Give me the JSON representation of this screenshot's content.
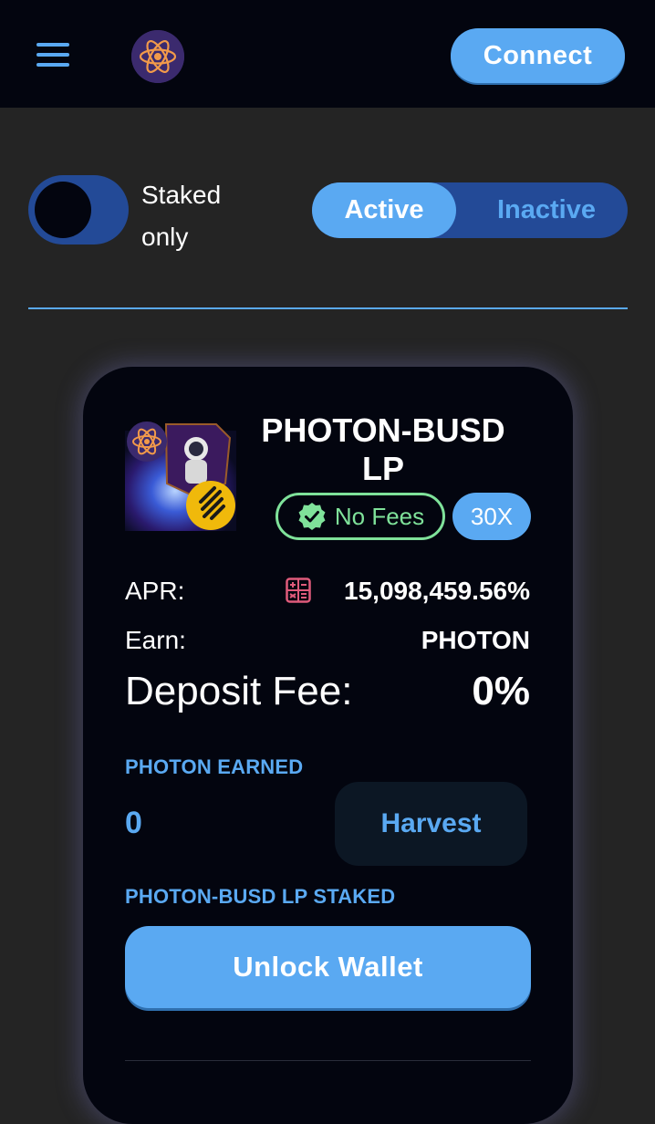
{
  "header": {
    "menu_icon": "hamburger-icon",
    "logo_icon": "atom-logo-icon",
    "connect_label": "Connect"
  },
  "filters": {
    "staked_only_label": "Staked only",
    "staked_only_on": false,
    "tabs": [
      {
        "label": "Active",
        "selected": true
      },
      {
        "label": "Inactive",
        "selected": false
      }
    ]
  },
  "farm": {
    "title": "PHOTON-BUSD LP",
    "image_icon": "photon-busd-lp-icon",
    "no_fees_label": "No Fees",
    "multiplier": "30X",
    "apr_label": "APR:",
    "apr_value": "15,098,459.56%",
    "earn_label": "Earn:",
    "earn_value": "PHOTON",
    "deposit_fee_label": "Deposit Fee:",
    "deposit_fee_value": "0%",
    "earned_label": "PHOTON EARNED",
    "earned_amount": "0",
    "harvest_label": "Harvest",
    "staked_label": "PHOTON-BUSD LP STAKED",
    "unlock_label": "Unlock Wallet"
  },
  "colors": {
    "accent": "#5aa9f2",
    "toggle_track": "#234a97",
    "card_bg": "#03050f",
    "page_bg": "#242424",
    "no_fees": "#7fe29a",
    "calculator": "#e05b7b"
  }
}
